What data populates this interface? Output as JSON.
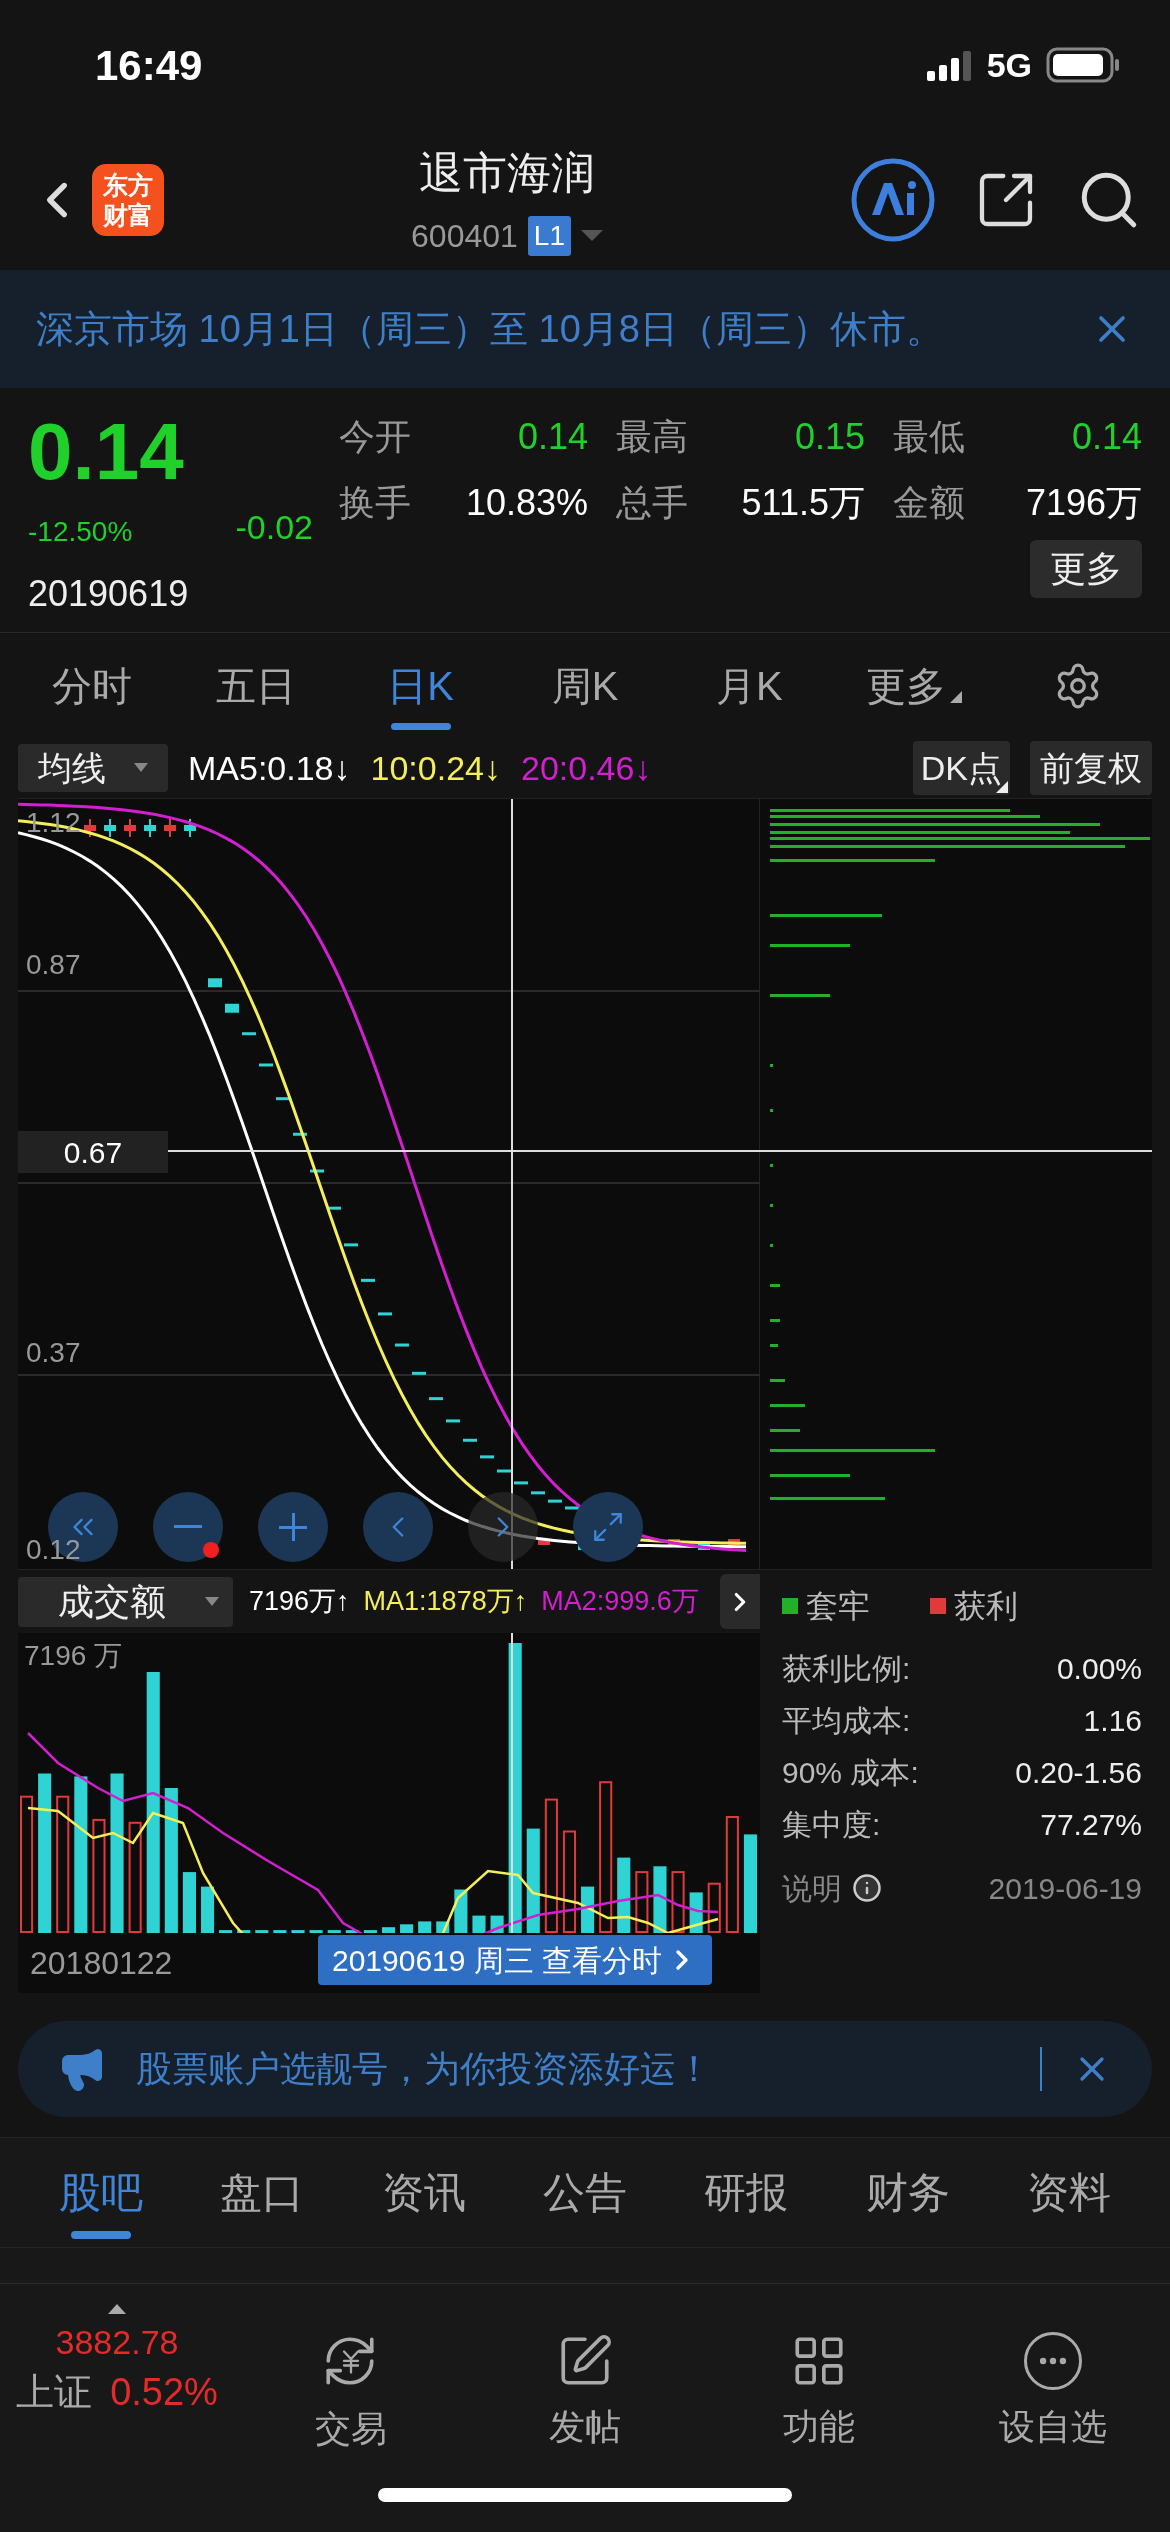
{
  "status_bar": {
    "time": "16:49",
    "network": "5G"
  },
  "header": {
    "logo": "东方财富",
    "title": "退市海润",
    "code": "600401",
    "level_badge": "L1"
  },
  "notice": {
    "text": "深京市场 10月1日（周三）至 10月8日（周三）休市。"
  },
  "quote": {
    "price": "0.14",
    "change_pct": "-12.50%",
    "change": "-0.02",
    "date": "20190619",
    "more_button": "更多",
    "stats": [
      {
        "label": "今开",
        "value": "0.14",
        "color": "#1fd12a"
      },
      {
        "label": "最高",
        "value": "0.15",
        "color": "#1fd12a"
      },
      {
        "label": "最低",
        "value": "0.14",
        "color": "#1fd12a"
      },
      {
        "label": "换手",
        "value": "10.83%",
        "color": "#ffffff"
      },
      {
        "label": "总手",
        "value": "511.5万",
        "color": "#ffffff"
      },
      {
        "label": "金额",
        "value": "7196万",
        "color": "#ffffff"
      }
    ]
  },
  "chart_tabs": [
    {
      "label": "分时",
      "selected": false,
      "kind": "tab"
    },
    {
      "label": "五日",
      "selected": false,
      "kind": "tab"
    },
    {
      "label": "日K",
      "selected": true,
      "kind": "tab"
    },
    {
      "label": "周K",
      "selected": false,
      "kind": "tab"
    },
    {
      "label": "月K",
      "selected": false,
      "kind": "tab"
    },
    {
      "label": "更多",
      "selected": false,
      "kind": "menu"
    }
  ],
  "indicator_bar": {
    "selector": "均线",
    "dk_button": "DK点",
    "adjust_button": "前复权",
    "items": [
      {
        "text": "MA5:0.18↓",
        "color": "#ffffff"
      },
      {
        "text": "10:0.24↓",
        "color": "#f4ee5a"
      },
      {
        "text": "20:0.46↓",
        "color": "#d21fd0"
      }
    ]
  },
  "main_chart": {
    "y_labels": [
      "1.12",
      "0.87",
      "0.37",
      "0.12"
    ],
    "crosshair_label": "0.67"
  },
  "volume_bar": {
    "selector": "成交额",
    "items": [
      {
        "text": "7196万↑",
        "color": "#ffffff"
      },
      {
        "text": "MA1:1878万↑",
        "color": "#f4ee5a"
      },
      {
        "text": "MA2:999.6万",
        "color": "#d21fd0"
      }
    ]
  },
  "volume_chart": {
    "max_label": "7196 万",
    "start_date": "20180122",
    "tooltip": "20190619 周三 查看分时"
  },
  "chip_panel": {
    "legend": [
      {
        "label": "套牢",
        "color": "#22b02a"
      },
      {
        "label": "获利",
        "color": "#e03a3a"
      }
    ],
    "stats": [
      {
        "label": "获利比例:",
        "value": "0.00%"
      },
      {
        "label": "平均成本:",
        "value": "1.16"
      },
      {
        "label": "90% 成本:",
        "value": "0.20-1.56"
      },
      {
        "label": "集中度:",
        "value": "77.27%"
      }
    ],
    "note_label": "说明",
    "note_date": "2019-06-19"
  },
  "promo": {
    "text": "股票账户选靓号，为你投资添好运！"
  },
  "section_tabs": [
    {
      "label": "股吧",
      "selected": true
    },
    {
      "label": "盘口",
      "selected": false
    },
    {
      "label": "资讯",
      "selected": false
    },
    {
      "label": "公告",
      "selected": false
    },
    {
      "label": "研报",
      "selected": false
    },
    {
      "label": "财务",
      "selected": false
    },
    {
      "label": "资料",
      "selected": false
    }
  ],
  "bottom_bar": {
    "index_value": "3882.78",
    "index_name": "上证",
    "index_change": "0.52%",
    "actions": [
      {
        "label": "交易",
        "kind": "trade"
      },
      {
        "label": "发帖",
        "kind": "post"
      },
      {
        "label": "功能",
        "kind": "apps"
      },
      {
        "label": "设自选",
        "kind": "more"
      }
    ]
  }
}
